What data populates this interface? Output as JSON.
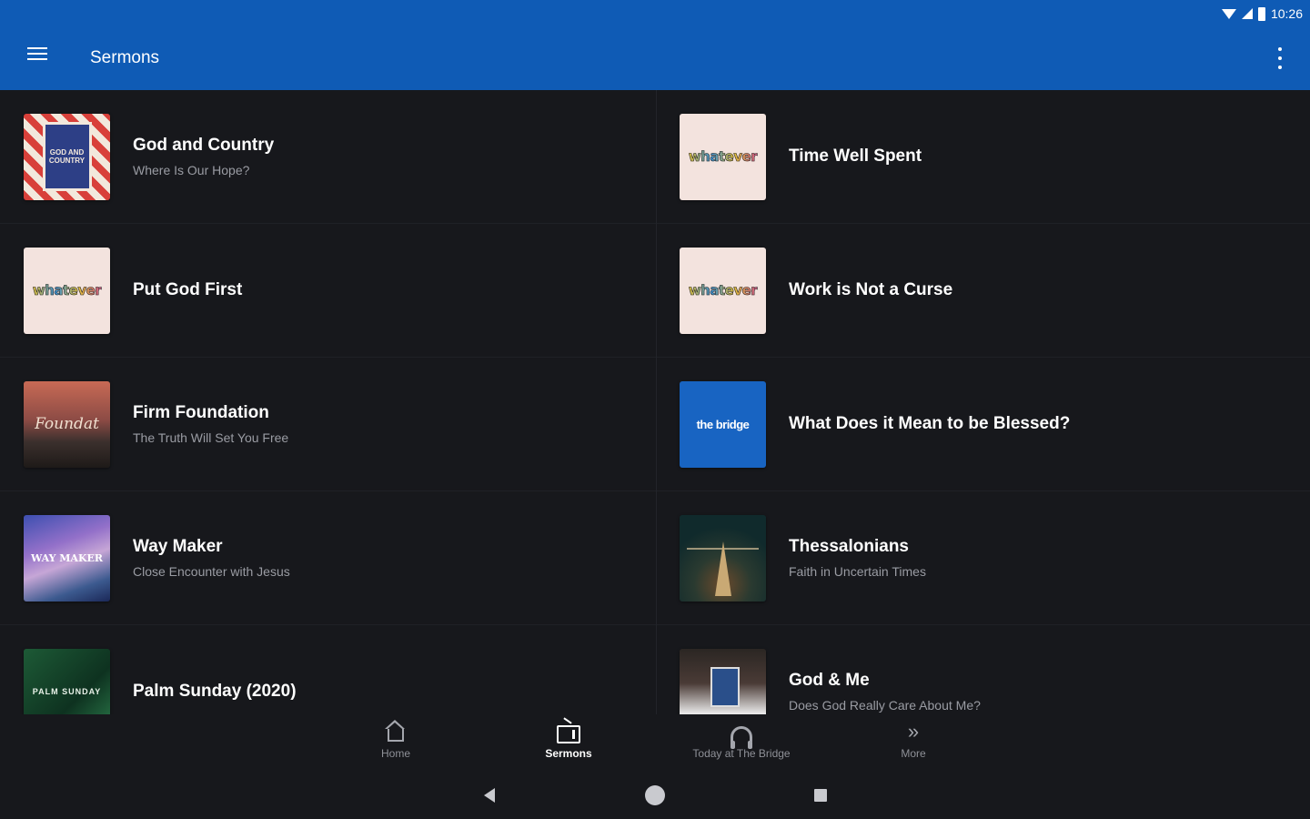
{
  "status_bar": {
    "time": "10:26"
  },
  "app_bar": {
    "title": "Sermons"
  },
  "sermons_left": [
    {
      "title": "God and Country",
      "subtitle": "Where Is Our Hope?",
      "thumb_text": "GOD AND COUNTRY"
    },
    {
      "title": "Put God First",
      "subtitle": "",
      "thumb_text": "whatever"
    },
    {
      "title": "Firm Foundation",
      "subtitle": "The Truth Will Set You Free",
      "thumb_text": "Foundat"
    },
    {
      "title": "Way Maker",
      "subtitle": "Close Encounter with Jesus",
      "thumb_text": "WAY MAKER"
    },
    {
      "title": "Palm Sunday (2020)",
      "subtitle": "",
      "thumb_text": "PALM SUNDAY"
    }
  ],
  "sermons_right": [
    {
      "title": "Time Well Spent",
      "subtitle": "",
      "thumb_text": "whatever"
    },
    {
      "title": "Work is Not a Curse",
      "subtitle": "",
      "thumb_text": "whatever"
    },
    {
      "title": "What Does it Mean to be Blessed?",
      "subtitle": "",
      "thumb_text": "the bridge"
    },
    {
      "title": "Thessalonians",
      "subtitle": "Faith in Uncertain Times",
      "thumb_text": ""
    },
    {
      "title": "God & Me",
      "subtitle": "Does God Really Care About Me?",
      "thumb_text": ""
    }
  ],
  "bottom_nav": {
    "items": [
      {
        "label": "Home",
        "icon": "home-icon"
      },
      {
        "label": "Sermons",
        "icon": "tv-icon",
        "active": true
      },
      {
        "label": "Today at The Bridge",
        "icon": "headphones-icon"
      },
      {
        "label": "More",
        "icon": "double-chevron-right-icon"
      }
    ]
  },
  "colors": {
    "app_bar": "#0f5bb5",
    "background": "#17181c",
    "bridge_thumb": "#1864c2"
  }
}
